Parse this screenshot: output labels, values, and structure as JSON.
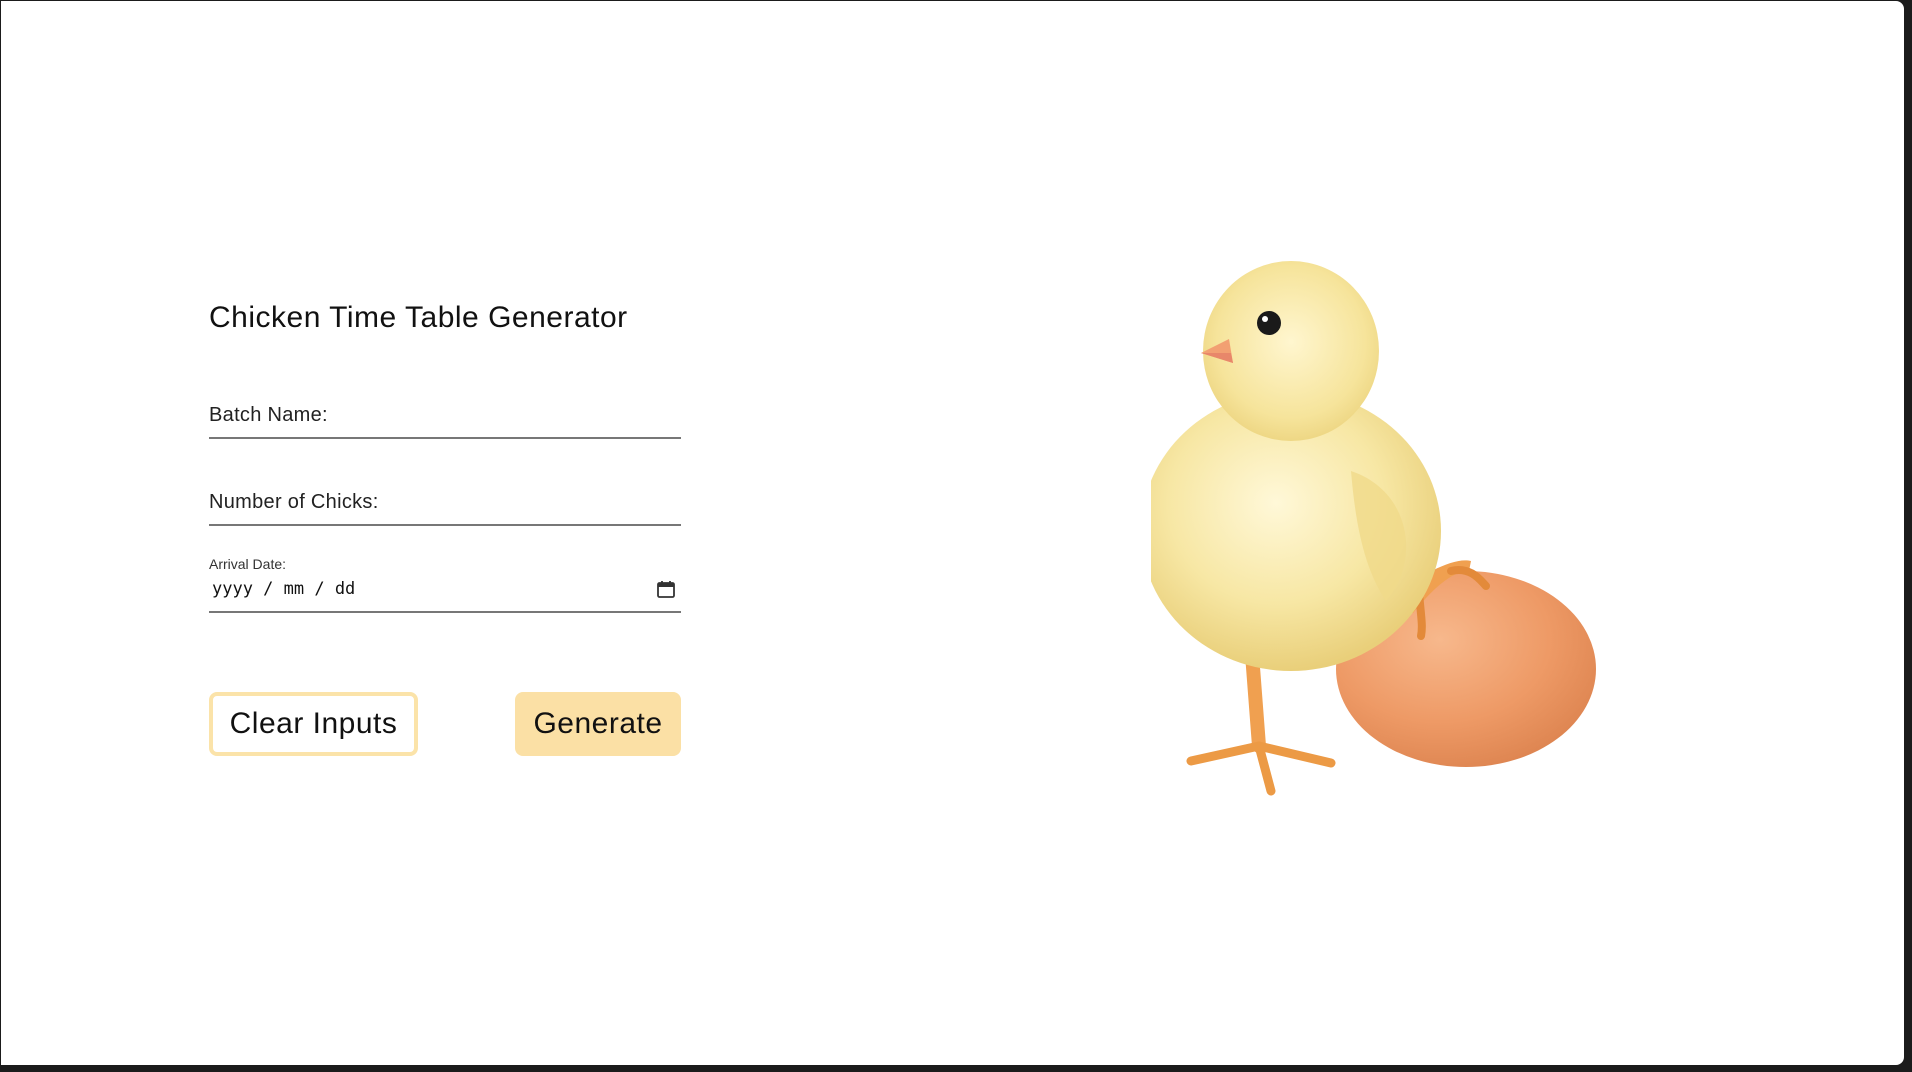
{
  "form": {
    "title": "Chicken Time Table Generator",
    "batch_name_label": "Batch Name:",
    "chicks_label": "Number of Chicks:",
    "arrival_label": "Arrival Date:",
    "arrival_placeholder": "yyyy / mm / dd",
    "clear_label": "Clear Inputs",
    "generate_label": "Generate"
  },
  "colors": {
    "accent": "#fbe0a5",
    "accent_border": "#fbe3a9"
  },
  "icons": {
    "calendar": "calendar-icon"
  }
}
